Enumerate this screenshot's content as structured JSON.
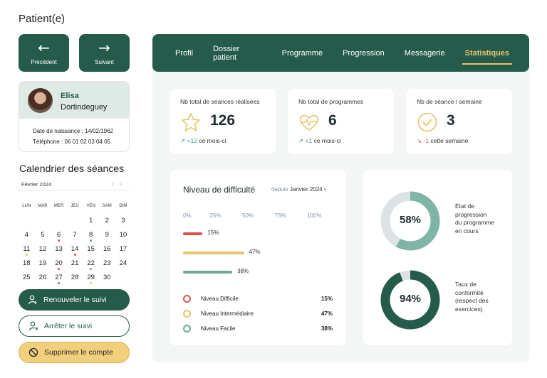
{
  "page_title": "Patient(e)",
  "nav": {
    "prev_label": "Précédent",
    "next_label": "Suivant",
    "prev_icon": "arrow-left-icon",
    "next_icon": "arrow-right-icon"
  },
  "patient": {
    "first_name": "Elisa",
    "last_name": "Dortindeguey",
    "birth_label": "Date de naissance :",
    "birth_value": "14/02/1962",
    "phone_label": "Téléphone :",
    "phone_value": "06 01 02 03 04 05"
  },
  "calendar": {
    "title": "Calendrier des séances",
    "month": "Février 2024",
    "prev_icon": "‹",
    "next_icon": "›",
    "weekdays": [
      "LUN",
      "MAR",
      "MER",
      "JEU",
      "VEN",
      "SAM",
      "DIM"
    ],
    "weeks": [
      [
        "",
        "",
        "",
        "",
        "1",
        "2",
        "3"
      ],
      [
        "4",
        "5",
        "6",
        "7",
        "8",
        "9",
        "10"
      ],
      [
        "11",
        "12",
        "13",
        "14",
        "15",
        "16",
        "17"
      ],
      [
        "18",
        "19",
        "20",
        "21",
        "22",
        "23",
        "24"
      ],
      [
        "25",
        "26",
        "27",
        "28",
        "29",
        "30",
        ""
      ]
    ],
    "session_dots": [
      {
        "day": "6",
        "color": "#d9534f"
      },
      {
        "day": "8",
        "color": "#6aa89a"
      },
      {
        "day": "11",
        "color": "#e8c36a"
      },
      {
        "day": "14",
        "color": "#d9534f"
      },
      {
        "day": "20",
        "color": "#d9534f"
      },
      {
        "day": "22",
        "color": "#6aa89a"
      },
      {
        "day": "27",
        "color": "#d9534f"
      },
      {
        "day": "29",
        "color": "#e8c36a"
      }
    ]
  },
  "actions": {
    "renew_label": "Renouveler le suivi",
    "stop_label": "Arrêter le suivi",
    "delete_label": "Supprimer le compte"
  },
  "tabs": [
    "Profil",
    "Dossier patient",
    "Programme",
    "Progression",
    "Messagerie",
    "Statistiques"
  ],
  "active_tab": "Statistiques",
  "stats": [
    {
      "label": "Nb total de séances réalisées",
      "value": "126",
      "delta": "+12",
      "delta_text": "ce mois-ci",
      "trend": "up",
      "icon": "star-icon"
    },
    {
      "label": "Nb total de programmes",
      "value": "6",
      "delta": "+1",
      "delta_text": "ce mois-ci",
      "trend": "up",
      "icon": "heart-pulse-icon"
    },
    {
      "label": "Nb de séance / semaine",
      "value": "3",
      "delta": "-1",
      "delta_text": "cette semaine",
      "trend": "down",
      "icon": "check-circle-icon"
    }
  ],
  "difficulty": {
    "title": "Niveau de difficulté",
    "since_label": "depuis",
    "since_value": "Janvier 2024",
    "axis_ticks": [
      "0%",
      "25%",
      "50%",
      "75%",
      "100%"
    ],
    "bars": [
      {
        "value": 15,
        "label": "15%",
        "color": "#d9534f"
      },
      {
        "value": 47,
        "label": "47%",
        "color": "#e8c36a"
      },
      {
        "value": 38,
        "label": "38%",
        "color": "#6aa89a"
      }
    ],
    "legend": [
      {
        "name": "Niveau Difficile",
        "pct": "15%",
        "color": "#d9534f"
      },
      {
        "name": "Niveau Intermédiaire",
        "pct": "47%",
        "color": "#e8c36a"
      },
      {
        "name": "Niveau Facile",
        "pct": "38%",
        "color": "#6aa89a"
      }
    ]
  },
  "progress": [
    {
      "value": 58,
      "label": "58%",
      "caption": [
        "État de",
        "progression",
        "du programme",
        "en cours"
      ],
      "color": "#7fb5a6",
      "track": "#dde3e5"
    },
    {
      "value": 94,
      "label": "94%",
      "caption": [
        "Taux de",
        "conformité",
        "(respect des",
        "exercices)"
      ],
      "color": "#245b4b",
      "track": "#dde3e5"
    }
  ]
}
